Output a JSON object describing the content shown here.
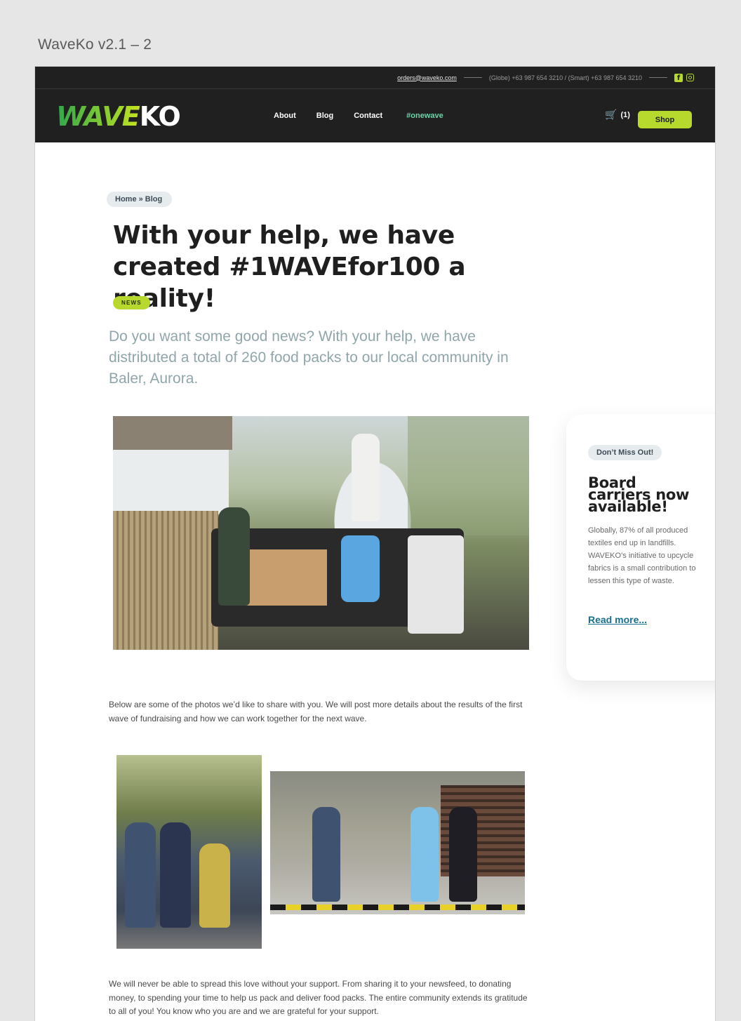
{
  "frame_title": "WaveKo v2.1 – 2",
  "topbar": {
    "email": "orders@waveko.com",
    "phones": "(Globe) +63 987 654 3210 / (Smart) +63 987 654 3210",
    "icons": [
      "facebook-icon",
      "instagram-icon"
    ]
  },
  "nav": {
    "logo_wave": "WAVE",
    "logo_ko": "KO",
    "links": [
      "About",
      "Blog",
      "Contact",
      "#onewave"
    ],
    "cart_count": "(1)",
    "shop_label": "Shop"
  },
  "article": {
    "breadcrumb": "Home » Blog",
    "title": "With your help, we have created #1WAVEfor100 a reality!",
    "tag": "NEWS",
    "lead": "Do you want some good news? With your help, we have distributed a total of 260 food packs to our local community in Baler, Aurora.",
    "paragraph1": "Below are some of the photos we’d like to share with you. We will post more details about the results of the first wave of fundraising and how we can work together for the next wave.",
    "paragraph2": "We will never be able to spread this love without your support. From sharing it to your newsfeed, to donating money, to spending your time to help us pack and deliver food packs. The entire community extends its gratitude to all of you! You know who you are and we are grateful for your support."
  },
  "sidebar": {
    "pill": "Don’t Miss Out!",
    "heading": "Board carriers now available!",
    "body": "Globally, 87% of all produced textiles end up in landfills. WAVEKO’s initiative to upcycle fabrics is a small contribution to lessen this type of waste.",
    "link": "Read more..."
  },
  "colors": {
    "accent": "#b7d92e",
    "dark": "#202020",
    "link": "#1a6f8c"
  }
}
